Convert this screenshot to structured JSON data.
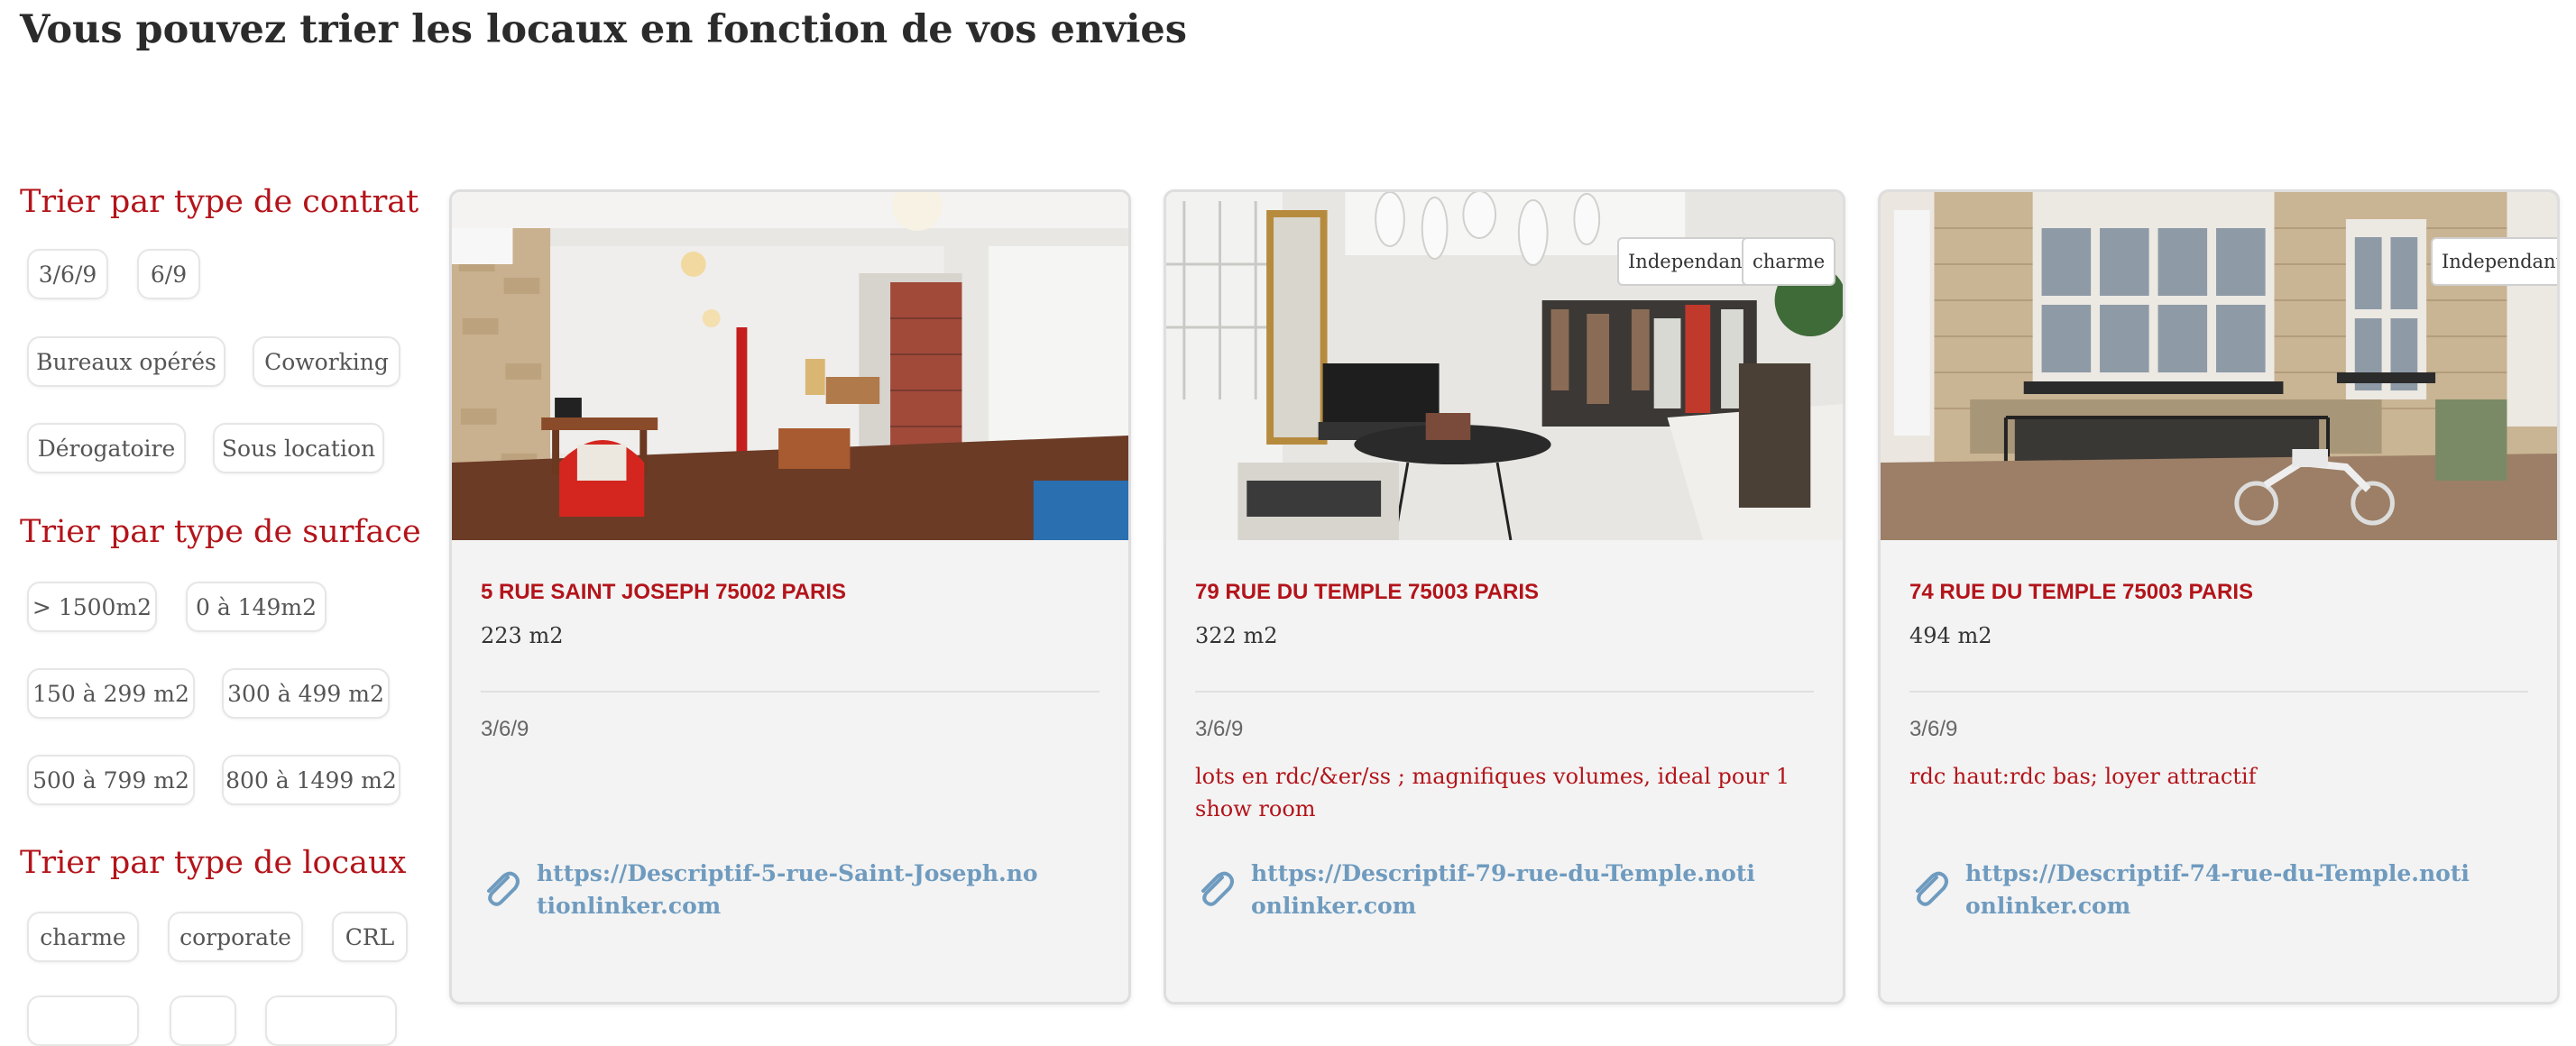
{
  "page": {
    "title": "Vous pouvez trier les locaux en fonction de vos envies"
  },
  "filters": {
    "contract": {
      "heading": "Trier par type de contrat",
      "chips": [
        "3/6/9",
        "6/9",
        "Bureaux opérés",
        "Coworking",
        "Dérogatoire",
        "Sous location"
      ]
    },
    "surface": {
      "heading": "Trier par type de surface",
      "chips": [
        "> 1500m2",
        "0 à 149m2",
        "150 à 299 m2",
        "300 à 499 m2",
        "500 à 799 m2",
        "800 à 1499 m2"
      ]
    },
    "locaux": {
      "heading": "Trier par type de locaux",
      "chips": [
        "charme",
        "corporate",
        "CRL"
      ]
    }
  },
  "listings": [
    {
      "address": "5 RUE SAINT JOSEPH 75002 PARIS",
      "surface": "223 m2",
      "contract": "3/6/9",
      "description": "",
      "tags": [],
      "link": "https://Descriptif-5-rue-Saint-Joseph.notionlinker.com",
      "photo_icon": "office-interior-photo"
    },
    {
      "address": "79 RUE DU TEMPLE 75003 PARIS",
      "surface": "322 m2",
      "contract": "3/6/9",
      "description": "lots en rdc/&er/ss ; magnifiques volumes, ideal pour 1 show room",
      "tags": [
        "Independant",
        "charme"
      ],
      "link": "https://Descriptif-79-rue-du-Temple.notionlinker.com",
      "photo_icon": "showroom-photo"
    },
    {
      "address": "74 RUE DU TEMPLE 75003 PARIS",
      "surface": "494 m2",
      "contract": "3/6/9",
      "description": "rdc haut:rdc bas; loyer attractif",
      "tags": [
        "Independant"
      ],
      "link": "https://Descriptif-74-rue-du-Temple.notionlinker.com",
      "photo_icon": "building-facade-photo"
    }
  ],
  "colors": {
    "accent": "#b3141a",
    "link": "#6f9bbf",
    "card_bg": "#f3f3f3"
  }
}
